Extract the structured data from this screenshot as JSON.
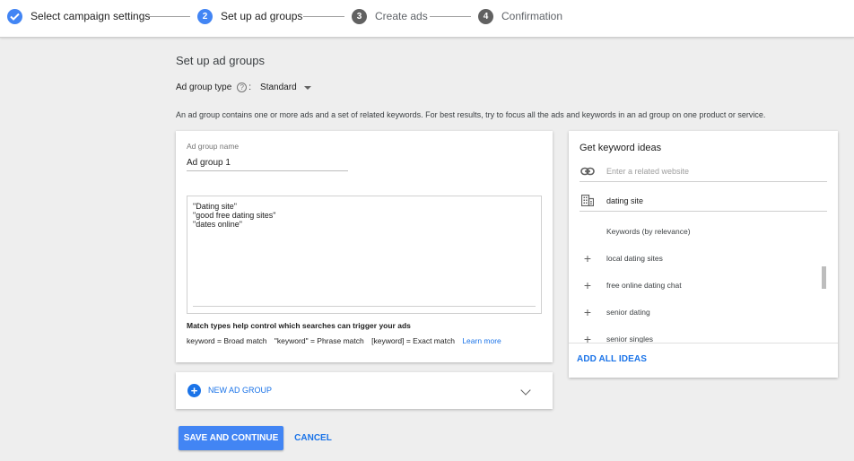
{
  "stepper": {
    "steps": [
      {
        "number": "",
        "label": "Select campaign settings",
        "state": "done"
      },
      {
        "number": "2",
        "label": "Set up ad groups",
        "state": "active"
      },
      {
        "number": "3",
        "label": "Create ads",
        "state": "pending"
      },
      {
        "number": "4",
        "label": "Confirmation",
        "state": "pending"
      }
    ]
  },
  "page": {
    "title": "Set up ad groups",
    "ad_group_type_label": "Ad group type",
    "ad_group_type_colon": ":",
    "ad_group_type_value": "Standard",
    "description": "An ad group contains one or more ads and a set of related keywords. For best results, try to focus all the ads and keywords in an ad group on one product or service."
  },
  "ad_group": {
    "name_label": "Ad group name",
    "name_value": "Ad group 1",
    "keywords": [
      "\"Dating site\"",
      "\"good free dating sites\"",
      "\"dates online\""
    ],
    "match_title": "Match types help control which searches can trigger your ads",
    "match_broad": "keyword = Broad match",
    "match_phrase": "\"keyword\" = Phrase match",
    "match_exact": "[keyword] = Exact match",
    "learn_more": "Learn more"
  },
  "keyword_ideas": {
    "title": "Get keyword ideas",
    "website_placeholder": "Enter a related website",
    "product_value": "dating site",
    "list_header": "Keywords (by relevance)",
    "ideas": [
      "local dating sites",
      "free online dating chat",
      "senior dating",
      "senior singles"
    ],
    "add_all": "ADD ALL IDEAS"
  },
  "new_ad_group": {
    "label": "NEW AD GROUP"
  },
  "actions": {
    "save": "SAVE AND CONTINUE",
    "cancel": "CANCEL"
  },
  "colors": {
    "accent": "#1a73e8",
    "primary_button": "#4285f4",
    "step_done": "#4285f4",
    "step_pending": "#616161"
  }
}
